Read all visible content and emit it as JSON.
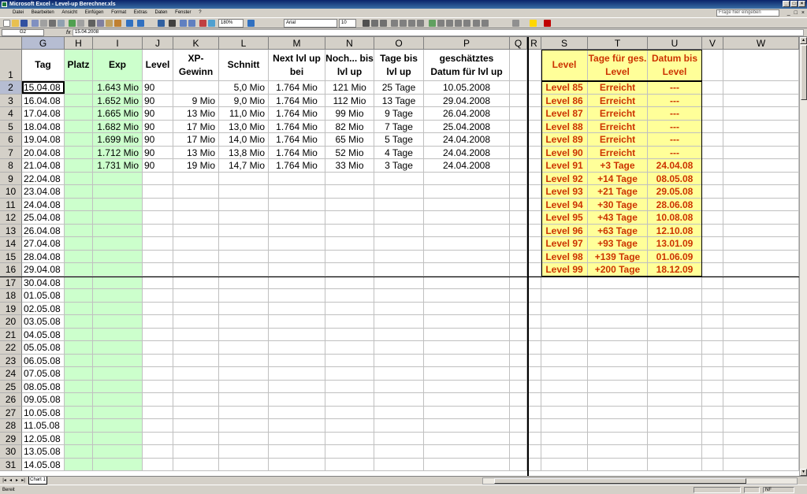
{
  "window": {
    "title": "Microsoft Excel - Level-up Berechner.xls"
  },
  "menu": {
    "items": [
      "Datei",
      "Bearbeiten",
      "Ansicht",
      "Einfügen",
      "Format",
      "Extras",
      "Daten",
      "Fenster",
      "?"
    ],
    "help_placeholder": "Frage hier eingeben"
  },
  "toolbar": {
    "zoom": "180%",
    "font": "Arial",
    "size": "10"
  },
  "formula": {
    "namebox": "G2",
    "fx": "fx",
    "content": "15.04.2008"
  },
  "columns": [
    "G",
    "H",
    "I",
    "J",
    "K",
    "L",
    "M",
    "N",
    "O",
    "P",
    "Q",
    "R",
    "S",
    "T",
    "U",
    "V",
    "W"
  ],
  "headers": {
    "G": "Tag",
    "H": "Platz",
    "I": "Exp",
    "J": "Level",
    "K": "XP-Gewinn",
    "L": "Schnitt",
    "M": "Next lvl up bei",
    "N": "Noch... bis lvl up",
    "O": "Tage bis lvl up",
    "P": "geschätztes Datum für lvl up",
    "S": "Level",
    "T": "Tage für ges. Level",
    "U": "Datum bis Level"
  },
  "rows": [
    {
      "n": "2",
      "G": "15.04.08",
      "I": "1.643 Mio",
      "J": "90",
      "K": "",
      "L": "5,0 Mio",
      "M": "1.764 Mio",
      "N": "121 Mio",
      "O": "25 Tage",
      "P": "10.05.2008",
      "S": "Level 85",
      "T": "Erreicht",
      "U": "---"
    },
    {
      "n": "3",
      "G": "16.04.08",
      "I": "1.652 Mio",
      "J": "90",
      "K": "9 Mio",
      "L": "9,0 Mio",
      "M": "1.764 Mio",
      "N": "112 Mio",
      "O": "13 Tage",
      "P": "29.04.2008",
      "S": "Level 86",
      "T": "Erreicht",
      "U": "---"
    },
    {
      "n": "4",
      "G": "17.04.08",
      "I": "1.665 Mio",
      "J": "90",
      "K": "13 Mio",
      "L": "11,0 Mio",
      "M": "1.764 Mio",
      "N": "99 Mio",
      "O": "9 Tage",
      "P": "26.04.2008",
      "S": "Level 87",
      "T": "Erreicht",
      "U": "---"
    },
    {
      "n": "5",
      "G": "18.04.08",
      "I": "1.682 Mio",
      "J": "90",
      "K": "17 Mio",
      "L": "13,0 Mio",
      "M": "1.764 Mio",
      "N": "82 Mio",
      "O": "7 Tage",
      "P": "25.04.2008",
      "S": "Level 88",
      "T": "Erreicht",
      "U": "---"
    },
    {
      "n": "6",
      "G": "19.04.08",
      "I": "1.699 Mio",
      "J": "90",
      "K": "17 Mio",
      "L": "14,0 Mio",
      "M": "1.764 Mio",
      "N": "65 Mio",
      "O": "5 Tage",
      "P": "24.04.2008",
      "S": "Level 89",
      "T": "Erreicht",
      "U": "---"
    },
    {
      "n": "7",
      "G": "20.04.08",
      "I": "1.712 Mio",
      "J": "90",
      "K": "13 Mio",
      "L": "13,8 Mio",
      "M": "1.764 Mio",
      "N": "52 Mio",
      "O": "4 Tage",
      "P": "24.04.2008",
      "S": "Level 90",
      "T": "Erreicht",
      "U": "---"
    },
    {
      "n": "8",
      "G": "21.04.08",
      "I": "1.731 Mio",
      "J": "90",
      "K": "19 Mio",
      "L": "14,7 Mio",
      "M": "1.764 Mio",
      "N": "33 Mio",
      "O": "3 Tage",
      "P": "24.04.2008",
      "S": "Level 91",
      "T": "+3 Tage",
      "U": "24.04.08"
    },
    {
      "n": "9",
      "G": "22.04.08",
      "S": "Level 92",
      "T": "+14 Tage",
      "U": "08.05.08"
    },
    {
      "n": "10",
      "G": "23.04.08",
      "S": "Level 93",
      "T": "+21 Tage",
      "U": "29.05.08"
    },
    {
      "n": "11",
      "G": "24.04.08",
      "S": "Level 94",
      "T": "+30 Tage",
      "U": "28.06.08"
    },
    {
      "n": "12",
      "G": "25.04.08",
      "S": "Level 95",
      "T": "+43 Tage",
      "U": "10.08.08"
    },
    {
      "n": "13",
      "G": "26.04.08",
      "S": "Level 96",
      "T": "+63 Tage",
      "U": "12.10.08"
    },
    {
      "n": "14",
      "G": "27.04.08",
      "S": "Level 97",
      "T": "+93 Tage",
      "U": "13.01.09"
    },
    {
      "n": "15",
      "G": "28.04.08",
      "S": "Level 98",
      "T": "+139 Tage",
      "U": "01.06.09"
    },
    {
      "n": "16",
      "G": "29.04.08",
      "S": "Level 99",
      "T": "+200 Tage",
      "U": "18.12.09"
    },
    {
      "n": "17",
      "G": "30.04.08"
    },
    {
      "n": "18",
      "G": "01.05.08"
    },
    {
      "n": "19",
      "G": "02.05.08"
    },
    {
      "n": "20",
      "G": "03.05.08"
    },
    {
      "n": "21",
      "G": "04.05.08"
    },
    {
      "n": "22",
      "G": "05.05.08"
    },
    {
      "n": "23",
      "G": "06.05.08"
    },
    {
      "n": "24",
      "G": "07.05.08"
    },
    {
      "n": "25",
      "G": "08.05.08"
    },
    {
      "n": "26",
      "G": "09.05.08"
    },
    {
      "n": "27",
      "G": "10.05.08"
    },
    {
      "n": "28",
      "G": "11.05.08"
    },
    {
      "n": "29",
      "G": "12.05.08"
    },
    {
      "n": "30",
      "G": "13.05.08"
    },
    {
      "n": "31",
      "G": "14.05.08"
    }
  ],
  "sheet": {
    "tab": "Chart 1"
  },
  "status": {
    "left": "Bereit",
    "right": "NF"
  }
}
